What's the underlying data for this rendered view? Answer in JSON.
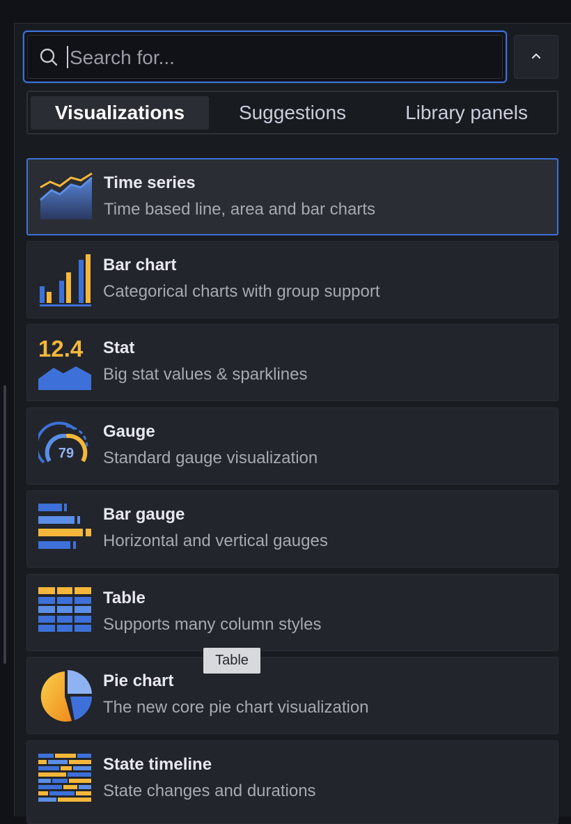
{
  "search": {
    "placeholder": "Search for..."
  },
  "tabs": [
    {
      "label": "Visualizations",
      "active": true
    },
    {
      "label": "Suggestions",
      "active": false
    },
    {
      "label": "Library panels",
      "active": false
    }
  ],
  "visualizations": [
    {
      "title": "Time series",
      "description": "Time based line, area and bar charts",
      "icon": "time-series-icon",
      "selected": true
    },
    {
      "title": "Bar chart",
      "description": "Categorical charts with group support",
      "icon": "bar-chart-icon"
    },
    {
      "title": "Stat",
      "description": "Big stat values & sparklines",
      "icon": "stat-icon",
      "icon_value": "12.4"
    },
    {
      "title": "Gauge",
      "description": "Standard gauge visualization",
      "icon": "gauge-icon",
      "icon_value": "79"
    },
    {
      "title": "Bar gauge",
      "description": "Horizontal and vertical gauges",
      "icon": "bar-gauge-icon"
    },
    {
      "title": "Table",
      "description": "Supports many column styles",
      "icon": "table-icon"
    },
    {
      "title": "Pie chart",
      "description": "The new core pie chart visualization",
      "icon": "pie-chart-icon"
    },
    {
      "title": "State timeline",
      "description": "State changes and durations",
      "icon": "state-timeline-icon"
    }
  ],
  "tooltip": {
    "text": "Table"
  },
  "colors": {
    "accent_blue": "#3d71d9",
    "icon_blue": "#5b8ee6",
    "icon_yellow": "#f5b73b",
    "panel": "#181b1f",
    "card": "#22252b"
  }
}
